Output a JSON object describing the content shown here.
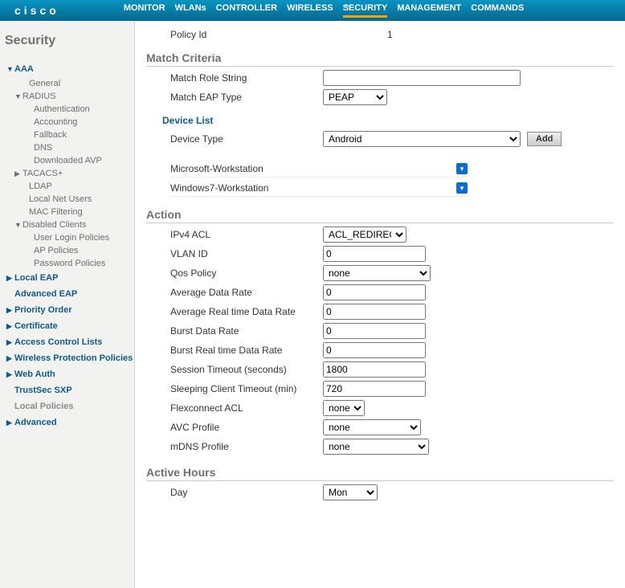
{
  "brand": "cisco",
  "nav": [
    "MONITOR",
    "WLANs",
    "CONTROLLER",
    "WIRELESS",
    "SECURITY",
    "MANAGEMENT",
    "COMMANDS"
  ],
  "nav_active_index": 4,
  "sidebar": {
    "title": "Security",
    "items": [
      {
        "label": "AAA",
        "type": "top",
        "open": true,
        "children": [
          {
            "label": "General",
            "type": "leaf"
          },
          {
            "label": "RADIUS",
            "type": "branch",
            "open": true,
            "children": [
              {
                "label": "Authentication"
              },
              {
                "label": "Accounting"
              },
              {
                "label": "Fallback"
              },
              {
                "label": "DNS"
              },
              {
                "label": "Downloaded AVP"
              }
            ]
          },
          {
            "label": "TACACS+",
            "type": "branch",
            "open": false
          },
          {
            "label": "LDAP",
            "type": "leaf"
          },
          {
            "label": "Local Net Users",
            "type": "leaf"
          },
          {
            "label": "MAC Filtering",
            "type": "leaf"
          },
          {
            "label": "Disabled Clients",
            "type": "branch",
            "open": true,
            "children": [
              {
                "label": "User Login Policies"
              },
              {
                "label": "AP Policies"
              },
              {
                "label": "Password Policies"
              }
            ]
          }
        ]
      },
      {
        "label": "Local EAP",
        "type": "top",
        "open": false
      },
      {
        "label": "Advanced EAP",
        "type": "top_plain"
      },
      {
        "label": "Priority Order",
        "type": "top",
        "open": false
      },
      {
        "label": "Certificate",
        "type": "top",
        "open": false
      },
      {
        "label": "Access Control Lists",
        "type": "top",
        "open": false
      },
      {
        "label": "Wireless Protection Policies",
        "type": "top",
        "open": false
      },
      {
        "label": "Web Auth",
        "type": "top",
        "open": false
      },
      {
        "label": "TrustSec SXP",
        "type": "top_plain"
      },
      {
        "label": "Local Policies",
        "type": "top_selected"
      },
      {
        "label": "Advanced",
        "type": "top",
        "open": false
      }
    ]
  },
  "policy": {
    "id_label": "Policy Id",
    "id_value": "1"
  },
  "match": {
    "title": "Match Criteria",
    "role_label": "Match Role String",
    "role_value": "",
    "eap_label": "Match EAP Type",
    "eap_value": "PEAP"
  },
  "device_list": {
    "title": "Device List",
    "type_label": "Device Type",
    "type_value": "Android",
    "add_label": "Add",
    "devices": [
      "Microsoft-Workstation",
      "Windows7-Workstation"
    ]
  },
  "action": {
    "title": "Action",
    "fields": [
      {
        "label": "IPv4 ACL",
        "type": "select",
        "value": "ACL_REDIRECT",
        "width": "104"
      },
      {
        "label": "VLAN ID",
        "type": "text",
        "value": "0"
      },
      {
        "label": "Qos Policy",
        "type": "select",
        "value": "none",
        "width": "134"
      },
      {
        "label": "Average Data Rate",
        "type": "text",
        "value": "0"
      },
      {
        "label": "Average Real time Data Rate",
        "type": "text",
        "value": "0"
      },
      {
        "label": "Burst Data Rate",
        "type": "text",
        "value": "0"
      },
      {
        "label": "Burst Real time Data Rate",
        "type": "text",
        "value": "0"
      },
      {
        "label": "Session Timeout (seconds)",
        "type": "text",
        "value": "1800"
      },
      {
        "label": "Sleeping Client Timeout (min)",
        "type": "text",
        "value": "720"
      },
      {
        "label": "Flexconnect ACL",
        "type": "select",
        "value": "none",
        "width": "52"
      },
      {
        "label": "AVC Profile",
        "type": "select",
        "value": "none",
        "width": "122"
      },
      {
        "label": "mDNS Profile",
        "type": "select",
        "value": "none",
        "width": "132"
      }
    ]
  },
  "active_hours": {
    "title": "Active Hours",
    "day_label": "Day",
    "day_value": "Mon"
  }
}
